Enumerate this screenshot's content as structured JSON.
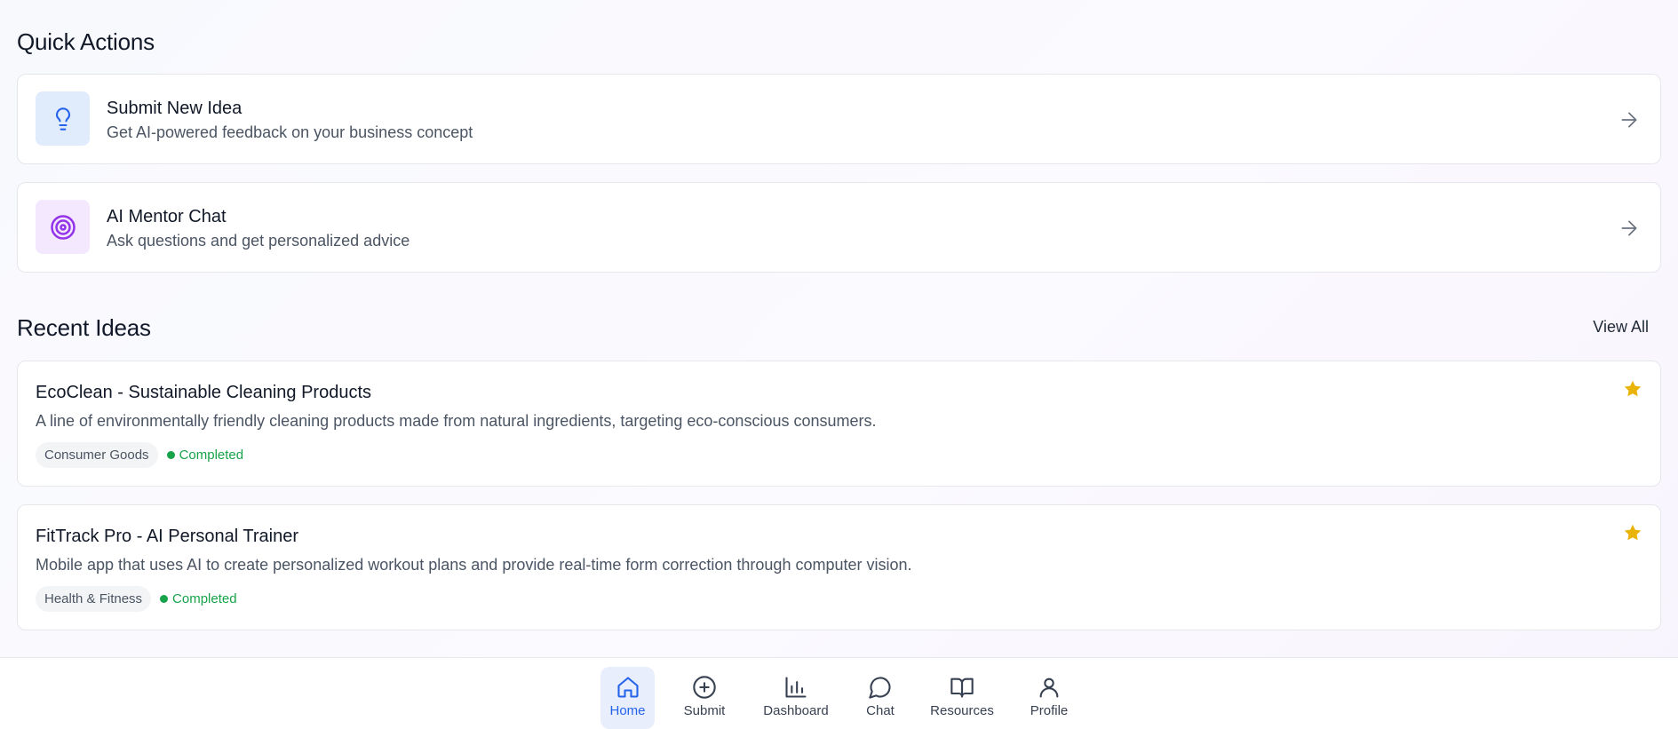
{
  "quick_actions": {
    "title": "Quick Actions",
    "items": [
      {
        "title": "Submit New Idea",
        "description": "Get AI-powered feedback on your business concept",
        "icon": "lightbulb-icon",
        "icon_bg": "#e0ebfc",
        "icon_color": "#2563eb"
      },
      {
        "title": "AI Mentor Chat",
        "description": "Ask questions and get personalized advice",
        "icon": "target-icon",
        "icon_bg": "#f3e8fd",
        "icon_color": "#9333ea"
      }
    ]
  },
  "recent_ideas": {
    "title": "Recent Ideas",
    "view_all": "View All",
    "items": [
      {
        "title": "EcoClean - Sustainable Cleaning Products",
        "description": "A line of environmentally friendly cleaning products made from natural ingredients, targeting eco-conscious consumers.",
        "category": "Consumer Goods",
        "status": "Completed",
        "starred": true
      },
      {
        "title": "FitTrack Pro - AI Personal Trainer",
        "description": "Mobile app that uses AI to create personalized workout plans and provide real-time form correction through computer vision.",
        "category": "Health & Fitness",
        "status": "Completed",
        "starred": true
      }
    ]
  },
  "nav": {
    "active": "Home",
    "items": [
      {
        "label": "Home",
        "icon": "home-icon"
      },
      {
        "label": "Submit",
        "icon": "plus-circle-icon"
      },
      {
        "label": "Dashboard",
        "icon": "bar-chart-icon"
      },
      {
        "label": "Chat",
        "icon": "chat-icon"
      },
      {
        "label": "Resources",
        "icon": "book-icon"
      },
      {
        "label": "Profile",
        "icon": "user-icon"
      }
    ]
  },
  "colors": {
    "accent": "#2563eb",
    "success": "#16a34a",
    "star": "#eab308"
  }
}
